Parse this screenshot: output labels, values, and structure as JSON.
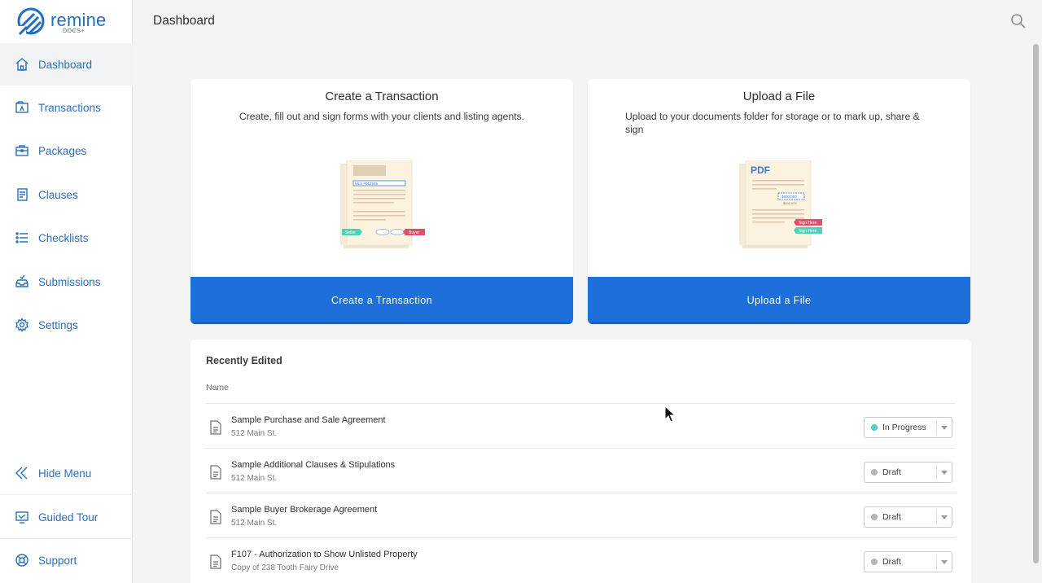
{
  "brand": {
    "name": "remine",
    "sub": "DOCS+",
    "color": "#1f6fc9"
  },
  "header": {
    "title": "Dashboard",
    "search_icon": "search-icon"
  },
  "sidebar": {
    "items": [
      {
        "label": "Dashboard",
        "icon": "home-icon",
        "active": true
      },
      {
        "label": "Transactions",
        "icon": "transactions-icon"
      },
      {
        "label": "Packages",
        "icon": "briefcase-icon"
      },
      {
        "label": "Clauses",
        "icon": "clause-document-icon"
      },
      {
        "label": "Checklists",
        "icon": "checklist-icon"
      },
      {
        "label": "Submissions",
        "icon": "submission-tray-icon"
      },
      {
        "label": "Settings",
        "icon": "gear-icon"
      }
    ],
    "footer": [
      {
        "label": "Hide Menu",
        "icon": "double-chevron-left-icon"
      },
      {
        "label": "Guided Tour",
        "icon": "guided-tour-icon"
      },
      {
        "label": "Support",
        "icon": "lifebuoy-icon"
      }
    ]
  },
  "cards": {
    "create": {
      "title": "Create a Transaction",
      "description": "Create, fill out and sign forms with your clients and listing agents.",
      "button": "Create a Transaction",
      "illus": {
        "mls": "MLS #012345",
        "seller": "Seller",
        "buyer": "Buyer"
      }
    },
    "upload": {
      "title": "Upload a File",
      "description": "Upload to your documents folder for storage or to mark up, share & sign",
      "button": "Upload a File",
      "illus": {
        "pdf": "PDF",
        "amount": "$600,000",
        "amount2": "$460,000",
        "sign1": "Sign Here",
        "sign2": "Sign Here"
      }
    }
  },
  "recent": {
    "title": "Recently Edited",
    "column_name": "Name",
    "rows": [
      {
        "name": "Sample Purchase and Sale Agreement",
        "address": "512 Main St.",
        "status": "In Progress",
        "status_color": "#4fd1c5"
      },
      {
        "name": "Sample Additional Clauses & Stipulations",
        "address": "512 Main St.",
        "status": "Draft",
        "status_color": "#b3b3b8"
      },
      {
        "name": "Sample Buyer Brokerage Agreement",
        "address": "512 Main St.",
        "status": "Draft",
        "status_color": "#b3b3b8"
      },
      {
        "name": "F107 - Authorization to Show Unlisted Property",
        "address": "Copy of 238 Tooth Fairy Drive",
        "status": "Draft",
        "status_color": "#b3b3b8"
      }
    ]
  },
  "colors": {
    "accent": "#1e6fd9",
    "nav": "#2b6fb8"
  }
}
